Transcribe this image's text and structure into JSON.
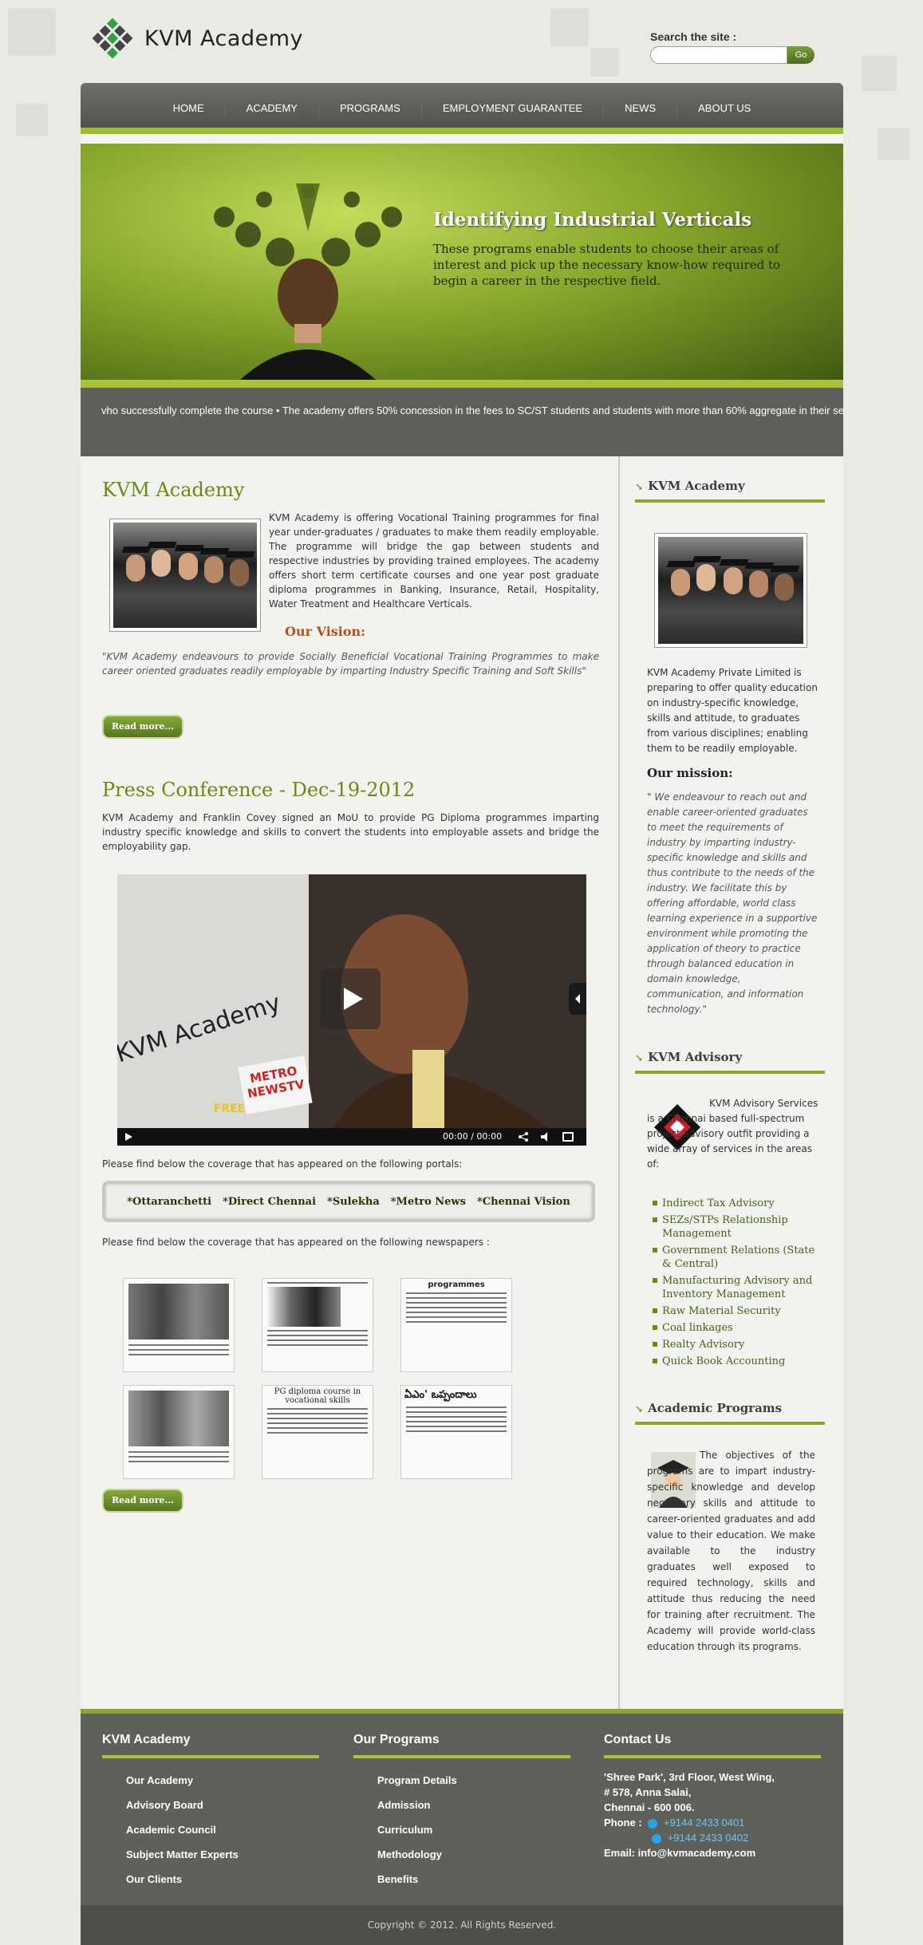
{
  "header": {
    "logo_text": "KVM Academy",
    "search_label": "Search the site :",
    "search_placeholder": "",
    "search_button": "Go"
  },
  "nav": [
    "HOME",
    "ACADEMY",
    "PROGRAMS",
    "EMPLOYMENT GUARANTEE",
    "NEWS",
    "ABOUT US"
  ],
  "banner": {
    "title": "Identifying Industrial Verticals",
    "text": "These programs enable students to choose their areas of interest and pick up the necessary know-how required to begin a career in the respective field."
  },
  "ticker": "vho successfully complete the course • The academy offers 50% concession in the fees to SC/ST students and students with more than 60% aggregate in their sem",
  "about": {
    "title": "KVM Academy",
    "text": "KVM Academy is offering Vocational Training programmes for final year under-graduates / graduates to make them readily employable. The programme will bridge the gap between students and respective industries by providing trained employees. The academy offers short term certificate courses and one year post graduate diploma programmes in Banking, Insurance, Retail, Hospitality, Water Treatment and Healthcare Verticals.",
    "vision_title": "Our Vision:",
    "vision_text": "\"KVM Academy endeavours to provide Socially Beneficial Vocational Training Programmes to make career oriented graduates readily employable by imparting Industry Specific Training and Soft Skills\"",
    "read_more": "Read more..."
  },
  "press": {
    "title": "Press Conference - Dec-19-2012",
    "text": "KVM Academy and Franklin Covey signed an MoU to provide PG Diploma programmes imparting industry specific knowledge and skills to convert the students into employable assets and bridge the employability gap.",
    "video_caption_brand": "HD Webplayer",
    "video_caption_tag": "FREE",
    "video_overlay": "KVM Academy",
    "video_mic": "METRO NEWSTV",
    "video_time": "00:00 / 00:00",
    "portals_intro": "Please find below the coverage that has appeared on the following portals:",
    "portals": [
      "*Ottaranchetti",
      "*Direct Chennai",
      "*Sulekha",
      "*Metro News",
      "*Chennai Vision"
    ],
    "newspapers_intro": "Please find below the coverage that has appeared on the following newspapers :",
    "news_headlines": [
      "programmes",
      "PG diploma course in vocational skills",
      "ఏఎం' ఒప్పందాలు"
    ],
    "read_more": "Read more..."
  },
  "sidebar": {
    "academy": {
      "title": "KVM Academy",
      "text": "KVM Academy Private Limited is preparing to offer quality education on industry-specific knowledge, skills and attitude, to graduates from various disciplines; enabling them to be readily employable.",
      "mission_title": "Our mission:",
      "mission_text": "\" We endeavour to reach out and enable career-oriented graduates to meet the requirements of industry by imparting industry-specific knowledge and skills and thus contribute to the needs of the industry. We facilitate this by offering affordable, world class learning experience in a supportive environment while promoting the application of theory to practice through balanced education in domain knowledge, communication, and information technology.\""
    },
    "advisory": {
      "title": "KVM Advisory",
      "text": "KVM Advisory Services is a Chennai based full-spectrum project advisory outfit providing a wide array of services in the areas of:",
      "items": [
        "Indirect Tax Advisory",
        "SEZs/STPs Relationship Management",
        "Government Relations (State & Central)",
        "Manufacturing Advisory and Inventory Management",
        "Raw Material Security",
        "Coal linkages",
        "Realty Advisory",
        "Quick Book Accounting"
      ]
    },
    "programs": {
      "title": "Academic Programs",
      "text": "The objectives of the programs are to impart industry-specific knowledge and develop necessary skills and attitude to career-oriented graduates and add value to their education. We make available to the industry graduates well exposed to required technology, skills and attitude thus reducing the need for training after recruitment. The Academy will provide world-class education through its programs."
    }
  },
  "footer": {
    "col1_title": "KVM Academy",
    "col1_links": [
      "Our Academy",
      "Advisory Board",
      "Academic Council",
      "Subject Matter Experts",
      "Our Clients"
    ],
    "col2_title": "Our Programs",
    "col2_links": [
      "Program Details",
      "Admission",
      "Curriculum",
      "Methodology",
      "Benefits"
    ],
    "col3_title": "Contact Us",
    "address1": "'Shree Park', 3rd Floor, West Wing,",
    "address2": "# 578, Anna Salai,",
    "address3": "Chennai - 600 006.",
    "phone_label": "Phone :",
    "phone1": "+9144 2433 0401",
    "phone2": "+9144 2433 0402",
    "email": "Email: info@kvmacademy.com",
    "copyright": "Copyright © 2012. All Rights Reserved."
  },
  "colors": {
    "accent_green": "#8aa72b",
    "dark_gray": "#5e605a",
    "title_green": "#6b8a14"
  }
}
